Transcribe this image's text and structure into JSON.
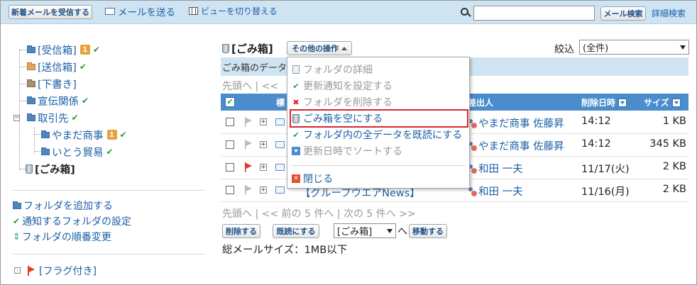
{
  "toolbar": {
    "receive_new_mail": "新着メールを受信する",
    "send_mail": "メールを送る",
    "switch_view": "ビューを切り替える",
    "search_value": "",
    "mail_search": "メール検索",
    "advanced_search": "詳細検索"
  },
  "sidebar": {
    "folders": {
      "inbox": {
        "label": "[受信箱]",
        "badge": "1"
      },
      "sent": {
        "label": "[送信箱]"
      },
      "drafts": {
        "label": "[下書き]"
      },
      "promo": {
        "label": "宣伝関係"
      },
      "clients": {
        "label": "取引先"
      },
      "yamada": {
        "label": "やまだ商事",
        "badge": "1"
      },
      "ito": {
        "label": "いとう貿易"
      },
      "trash": {
        "label": "[ごみ箱]"
      }
    },
    "add_folder": "フォルダを追加する",
    "notify_settings": "通知するフォルダの設定",
    "reorder_folders": "フォルダの順番変更",
    "flagged": "[フラグ付き]"
  },
  "main": {
    "title": "[ごみ箱]",
    "other_actions": "その他の操作",
    "filter_label": "絞込",
    "filter_value": "(全件)",
    "info_text": "ごみ箱のデータ",
    "pager_top": "先頭へ | <<",
    "pager_bottom": "先頭へ | << 前の 5 件へ | 次の 5 件へ >>",
    "columns": {
      "subject_frag": "標",
      "sender": "差出人",
      "deleted_at": "削除日時",
      "size": "サイズ"
    },
    "rows": [
      {
        "sender": "やまだ商事 佐藤昇",
        "date": "14:12",
        "size": "1 KB",
        "flag_color": "#bdbdbd"
      },
      {
        "sender": "やまだ商事 佐藤昇",
        "date": "14:12",
        "size": "345 KB",
        "flag_color": "#bdbdbd"
      },
      {
        "sender": "和田 一夫",
        "date": "11/17(火)",
        "size": "2 KB",
        "flag_color": "#e03b2a"
      },
      {
        "sender": "和田 一夫",
        "date": "11/16(月)",
        "size": "2 KB",
        "flag_color": "#bdbdbd",
        "subject": "【グループウエアNews】"
      }
    ],
    "delete_btn": "削除する",
    "mark_read_btn": "既読にする",
    "move_target": "[ごみ箱]",
    "move_to_suffix": "へ",
    "move_btn": "移動する",
    "total_size": "総メールサイズ：1MB以下"
  },
  "menu": {
    "items": [
      {
        "label": "フォルダの詳細",
        "icon": "magnifier-icon"
      },
      {
        "label": "更新通知を設定する",
        "icon": "checkmark-icon"
      },
      {
        "label": "フォルダを削除する",
        "icon": "x-mark-icon"
      },
      {
        "label": "ごみ箱を空にする",
        "icon": "trash-icon"
      },
      {
        "label": "フォルダ内の全データを既読にする",
        "icon": "mark-read-icon"
      },
      {
        "label": "更新日時でソートする",
        "icon": "sort-down-icon"
      },
      {
        "label": "閉じる",
        "icon": "close-icon"
      }
    ]
  },
  "colors": {
    "accent_blue": "#4a8ccc",
    "toolbar_bg": "#cfe4f3",
    "highlight_red": "#d9262b",
    "check_green": "#2e9a3a"
  }
}
